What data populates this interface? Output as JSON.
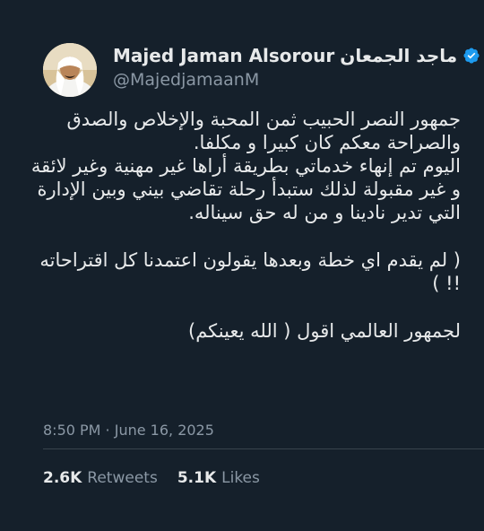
{
  "author": {
    "display_name_en": "Majed Jaman Alsorour",
    "display_name_ar": "ماجد الجمعان",
    "handle": "@MajedjamaanM",
    "verified_icon": "verified-badge-icon"
  },
  "tweet": {
    "paragraphs": [
      "جمهور النصر الحبيب ثمن المحبة والإخلاص والصدق والصراحة معكم كان كبيرا و مكلفا.\nاليوم تم إنهاء خدماتي بطريقة أراها غير مهنية وغير لائقة و غير مقبولة لذلك ستبدأ رحلة تقاضي بيني وبين الإدارة التي تدير نادينا و من له حق سيناله.",
      "( لم يقدم اي خطة  وبعدها يقولون اعتمدنا كل اقتراحاته !! )",
      "لجمهور العالمي اقول ( الله يعينكم)"
    ],
    "timestamp": "8:50 PM · June 16, 2025"
  },
  "stats": {
    "retweets_count": "2.6K",
    "retweets_label": "Retweets",
    "likes_count": "5.1K",
    "likes_label": "Likes"
  },
  "colors": {
    "background": "#15202b",
    "text": "#e7e9ea",
    "muted": "#8b98a5",
    "verified": "#1d9bf0"
  }
}
